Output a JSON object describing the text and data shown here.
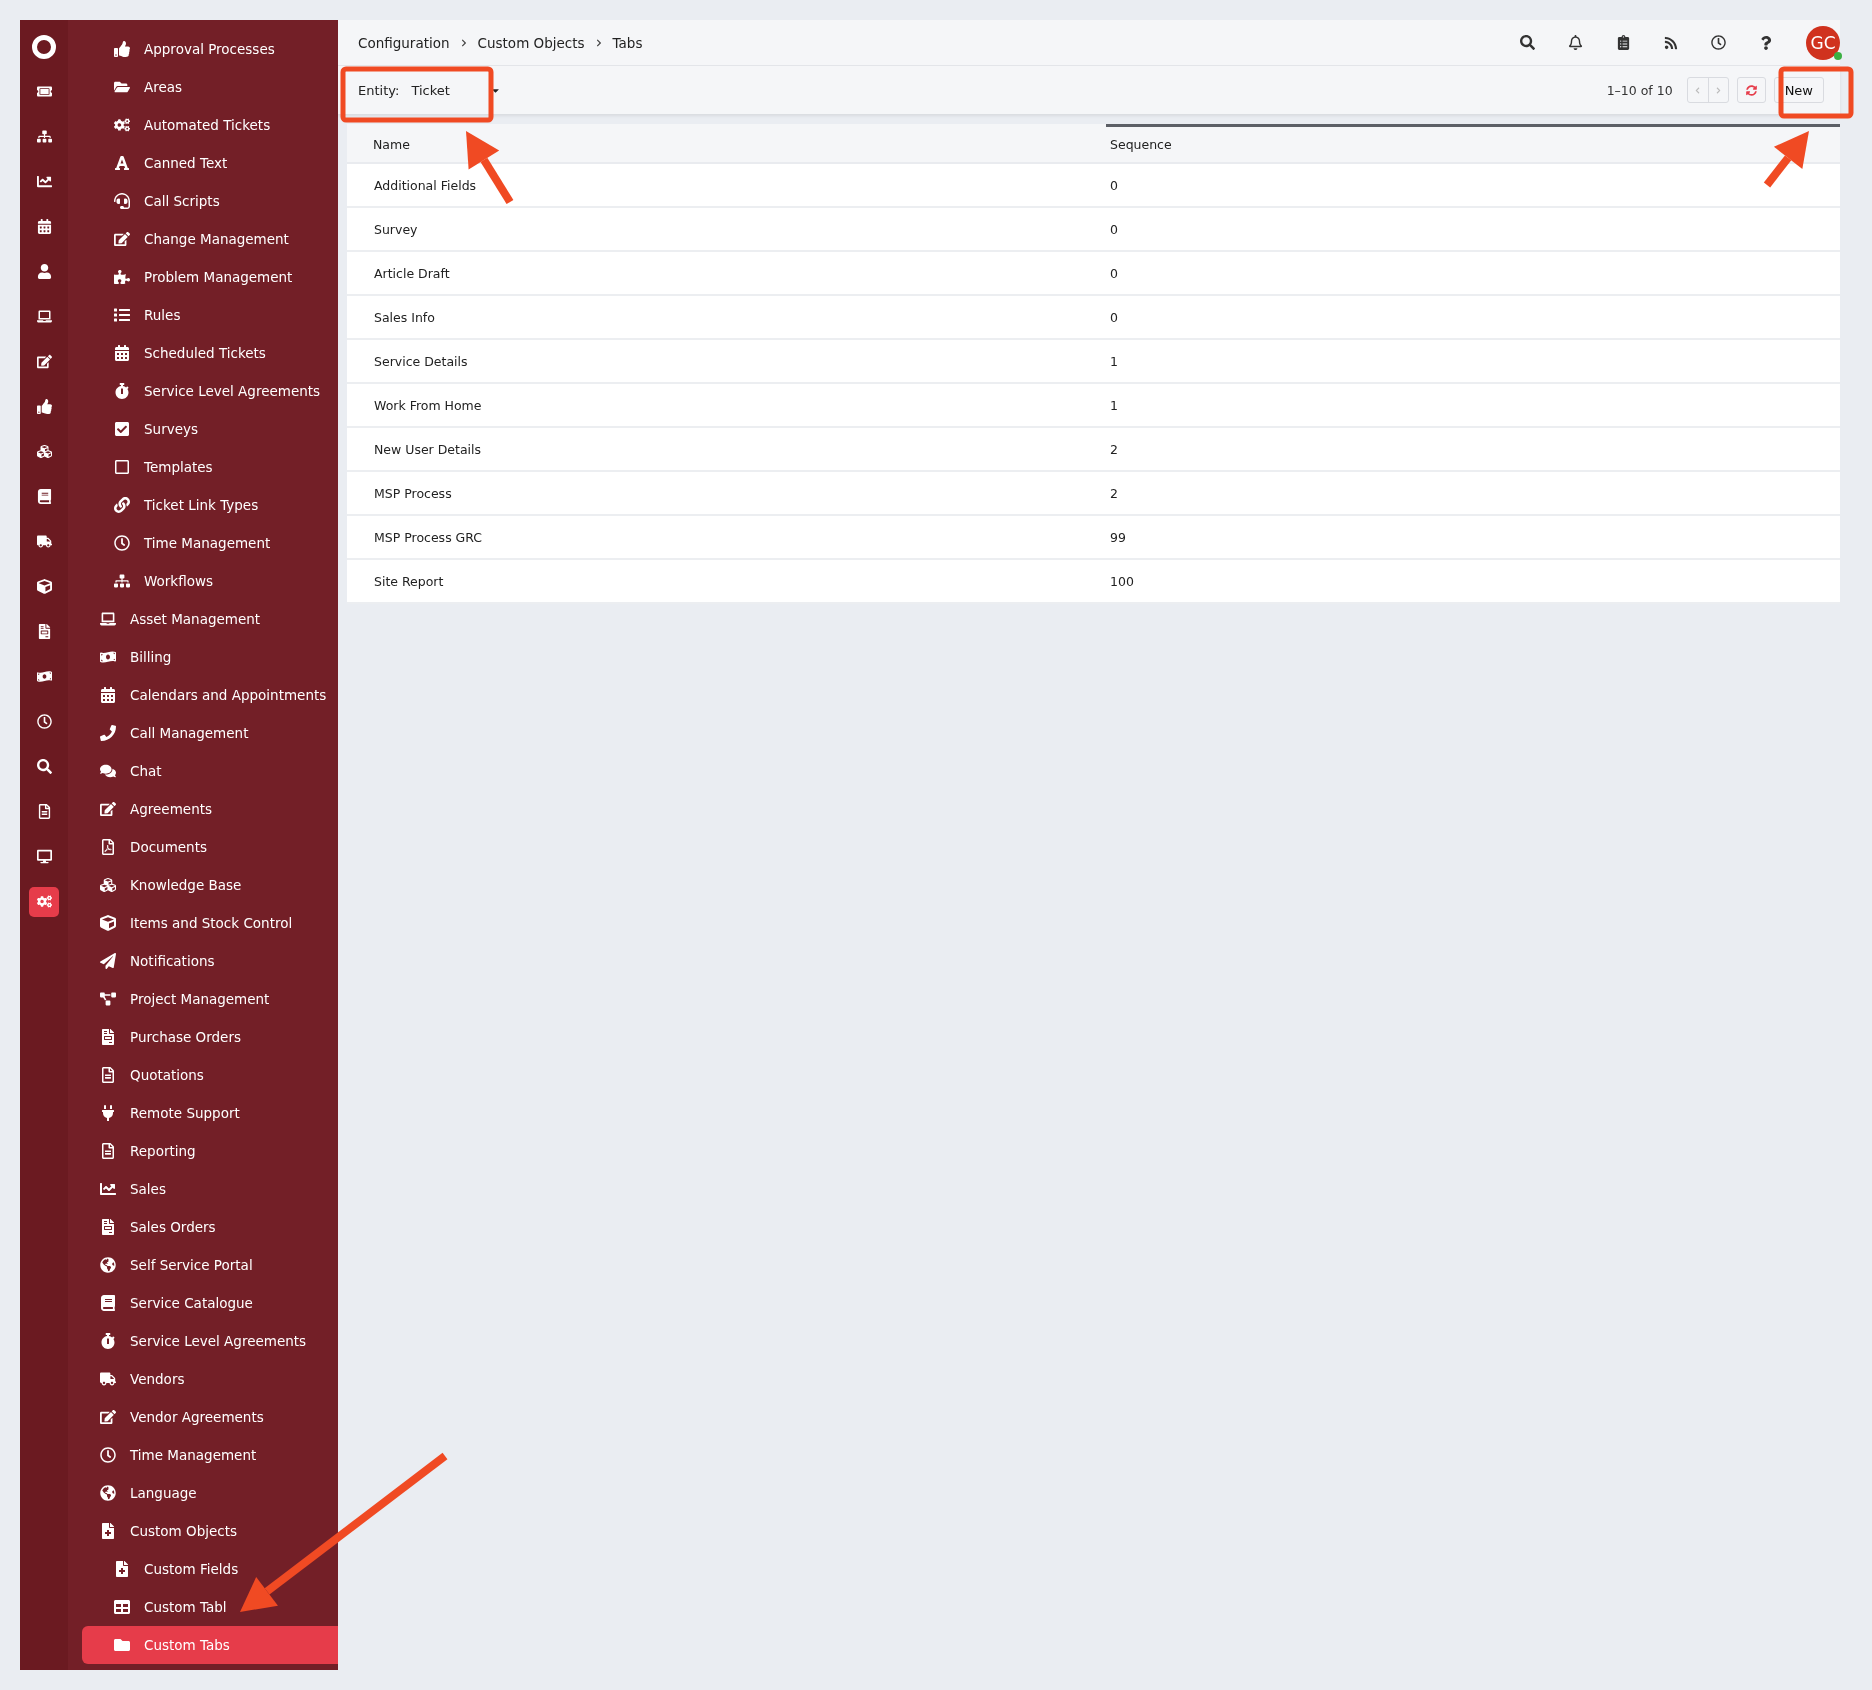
{
  "rail": [
    {
      "selected": false
    },
    {
      "selected": false
    },
    {
      "selected": false
    },
    {
      "selected": false
    },
    {
      "selected": false
    },
    {
      "selected": false
    },
    {
      "selected": false
    },
    {
      "selected": false
    },
    {
      "selected": false
    },
    {
      "selected": false
    },
    {
      "selected": false
    },
    {
      "selected": false
    },
    {
      "selected": false
    },
    {
      "selected": false
    },
    {
      "selected": false
    },
    {
      "selected": false
    },
    {
      "selected": false
    },
    {
      "selected": false
    },
    {
      "selected": true
    }
  ],
  "sidebar": {
    "sub_items": [
      {
        "label": "Approval Processes",
        "selected": false
      },
      {
        "label": "Areas",
        "selected": false
      },
      {
        "label": "Automated Tickets",
        "selected": false
      },
      {
        "label": "Canned Text",
        "selected": false
      },
      {
        "label": "Call Scripts",
        "selected": false
      },
      {
        "label": "Change Management",
        "selected": false
      },
      {
        "label": "Problem Management",
        "selected": false
      },
      {
        "label": "Rules",
        "selected": false
      },
      {
        "label": "Scheduled Tickets",
        "selected": false
      },
      {
        "label": "Service Level Agreements",
        "selected": false
      },
      {
        "label": "Surveys",
        "selected": false
      },
      {
        "label": "Templates",
        "selected": false
      },
      {
        "label": "Ticket Link Types",
        "selected": false
      },
      {
        "label": "Time Management",
        "selected": false
      },
      {
        "label": "Workflows",
        "selected": false
      }
    ],
    "items": [
      {
        "label": "Asset Management",
        "selected": false
      },
      {
        "label": "Billing",
        "selected": false
      },
      {
        "label": "Calendars and Appointments",
        "selected": false
      },
      {
        "label": "Call Management",
        "selected": false
      },
      {
        "label": "Chat",
        "selected": false
      },
      {
        "label": "Agreements",
        "selected": false
      },
      {
        "label": "Documents",
        "selected": false
      },
      {
        "label": "Knowledge Base",
        "selected": false
      },
      {
        "label": "Items and Stock Control",
        "selected": false
      },
      {
        "label": "Notifications",
        "selected": false
      },
      {
        "label": "Project Management",
        "selected": false
      },
      {
        "label": "Purchase Orders",
        "selected": false
      },
      {
        "label": "Quotations",
        "selected": false
      },
      {
        "label": "Remote Support",
        "selected": false
      },
      {
        "label": "Reporting",
        "selected": false
      },
      {
        "label": "Sales",
        "selected": false
      },
      {
        "label": "Sales Orders",
        "selected": false
      },
      {
        "label": "Self Service Portal",
        "selected": false
      },
      {
        "label": "Service Catalogue",
        "selected": false
      },
      {
        "label": "Service Level Agreements",
        "selected": false
      },
      {
        "label": "Vendors",
        "selected": false
      },
      {
        "label": "Vendor Agreements",
        "selected": false
      },
      {
        "label": "Time Management",
        "selected": false
      },
      {
        "label": "Language",
        "selected": false
      },
      {
        "label": "Custom Objects",
        "selected": false,
        "children": [
          {
            "label": "Custom Fields",
            "selected": false
          },
          {
            "label": "Custom Tabl",
            "selected": false
          },
          {
            "label": "Custom Tabs",
            "selected": true
          }
        ]
      }
    ]
  },
  "breadcrumbs": [
    "Configuration",
    "Custom Objects",
    "Tabs"
  ],
  "avatar": "GC",
  "toolbar": {
    "entity_label": "Entity:",
    "entity_value": "Ticket",
    "pagination": "1–10 of 10",
    "new_button": "New"
  },
  "table": {
    "columns": [
      "Name",
      "Sequence"
    ],
    "rows": [
      [
        "Additional Fields",
        "0"
      ],
      [
        "Survey",
        "0"
      ],
      [
        "Article Draft",
        "0"
      ],
      [
        "Sales Info",
        "0"
      ],
      [
        "Service Details",
        "1"
      ],
      [
        "Work From Home",
        "1"
      ],
      [
        "New User Details",
        "2"
      ],
      [
        "MSP Process",
        "2"
      ],
      [
        "MSP Process GRC",
        "99"
      ],
      [
        "Site Report",
        "100"
      ]
    ]
  }
}
